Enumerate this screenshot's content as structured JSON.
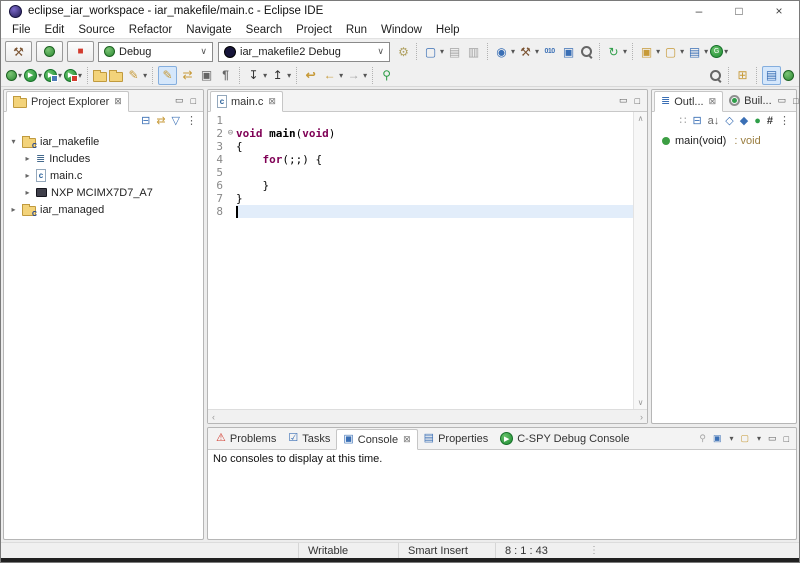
{
  "window": {
    "title": "eclipse_iar_workspace - iar_makefile/main.c - Eclipse IDE"
  },
  "window_controls": {
    "minimize": "–",
    "maximize": "□",
    "close": "×"
  },
  "menu": {
    "items": [
      "File",
      "Edit",
      "Source",
      "Refactor",
      "Navigate",
      "Search",
      "Project",
      "Run",
      "Window",
      "Help"
    ]
  },
  "toolbar1": {
    "debug_combo": "Debug",
    "launch_combo": "iar_makefile2 Debug",
    "binary": "010"
  },
  "explorer": {
    "title": "Project Explorer",
    "items": [
      "iar_makefile",
      "Includes",
      "main.c",
      "NXP MCIMX7D7_A7",
      "iar_managed"
    ]
  },
  "editor": {
    "tab": "main.c",
    "line_numbers": [
      "1",
      "2",
      "3",
      "4",
      "5",
      "6",
      "7",
      "8"
    ],
    "code": {
      "l2_kw1": "void",
      "l2_sp": " ",
      "l2_name": "main",
      "l2_p1": "(",
      "l2_kw2": "void",
      "l2_p2": ")",
      "l3": "{",
      "l4_ind": "    ",
      "l4_kw": "for",
      "l4_rest": "(;;) {",
      "l6": "    }",
      "l7": "}"
    }
  },
  "outline": {
    "tab_outline": "Outl...",
    "tab_build": "Buil...",
    "item": "main(void)",
    "item_type": " : void"
  },
  "console": {
    "tabs": [
      "Problems",
      "Tasks",
      "Console",
      "Properties",
      "C-SPY Debug Console"
    ],
    "message": "No consoles to display at this time."
  },
  "status": {
    "writable": "Writable",
    "insert": "Smart Insert",
    "position": "8 : 1 : 43"
  },
  "icons": {
    "hammer": "⚒",
    "stop": "■",
    "chevron": "▾",
    "combo_chevron": "∨",
    "gear": "⚙",
    "new_wizard": "▢",
    "save": "▤",
    "save_all": "▥",
    "globe": "◉",
    "console_view": "▣",
    "external_tools": "↻",
    "new_c_project": "▣",
    "new_project": "▢",
    "new_c_file": "▤",
    "green_g": "G",
    "run_play": "▶",
    "pilcrow": "¶",
    "brush": "✎",
    "feather": "✎",
    "link": "⇄",
    "mark": "▣",
    "next_annotation": "↧",
    "prev_annotation": "↥",
    "last_edit": "↩",
    "back": "←",
    "forward": "→",
    "pin": "⚲",
    "open_perspective": "⊞",
    "cpp_perspective": "▤",
    "collapse_all": "⊟",
    "link_editor": "⇄",
    "filter": "▽",
    "view_menu": "⋮",
    "minimize_view": "▭",
    "maximize_view": "□",
    "tab_close": "⊠",
    "fold_minus": "⊖",
    "arrow_expanded": "▾",
    "arrow_collapsed": "▸",
    "outline_tab": "≣",
    "includes": "≣",
    "c_letter": "c",
    "c_overlay": "C",
    "dots_pair": "∷",
    "sort_az": "a↓",
    "hide_fields": "◇",
    "hide_static": "◆",
    "hide_nonpublic": "●",
    "hide_inactive": "#",
    "problems": "⚠",
    "tasks": "☑",
    "properties": "▤",
    "cspy_play": "▶",
    "hscroll_left": "‹",
    "hscroll_right": "›",
    "vscroll_up": "∧",
    "vscroll_down": "∨"
  },
  "colors": {
    "keyword": "#7f0055",
    "current_line": "#e2edfa",
    "accent_green": "#2f9e49",
    "stop_red": "#d23b2e"
  }
}
